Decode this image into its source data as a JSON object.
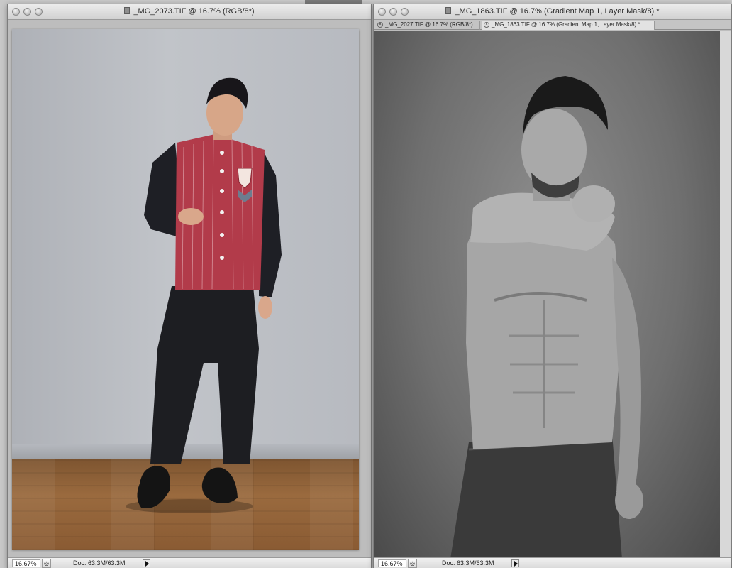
{
  "left_window": {
    "title": "_MG_2073.TIF @ 16.7% (RGB/8*)",
    "status": {
      "zoom": "16.67%",
      "doc_info": "Doc: 63.3M/63.3M"
    }
  },
  "right_window": {
    "title": "_MG_1863.TIF @ 16.7% (Gradient Map 1, Layer Mask/8) *",
    "tabs": [
      {
        "label": "_MG_2027.TIF @ 16.7% (RGB/8*)",
        "active": false
      },
      {
        "label": "_MG_1863.TIF @ 16.7% (Gradient Map 1, Layer Mask/8) *",
        "active": true
      }
    ],
    "status": {
      "zoom": "16.67%",
      "doc_info": "Doc: 63.3M/63.3M"
    }
  },
  "colors": {
    "jacket_red": "#b23b4a",
    "backdrop_grey": "#b6b9bf",
    "floor_wood": "#8f6038"
  },
  "icons": [
    "close-icon",
    "minimize-icon",
    "zoom-icon",
    "document-icon",
    "tab-close-icon",
    "status-menu-arrow-icon"
  ]
}
